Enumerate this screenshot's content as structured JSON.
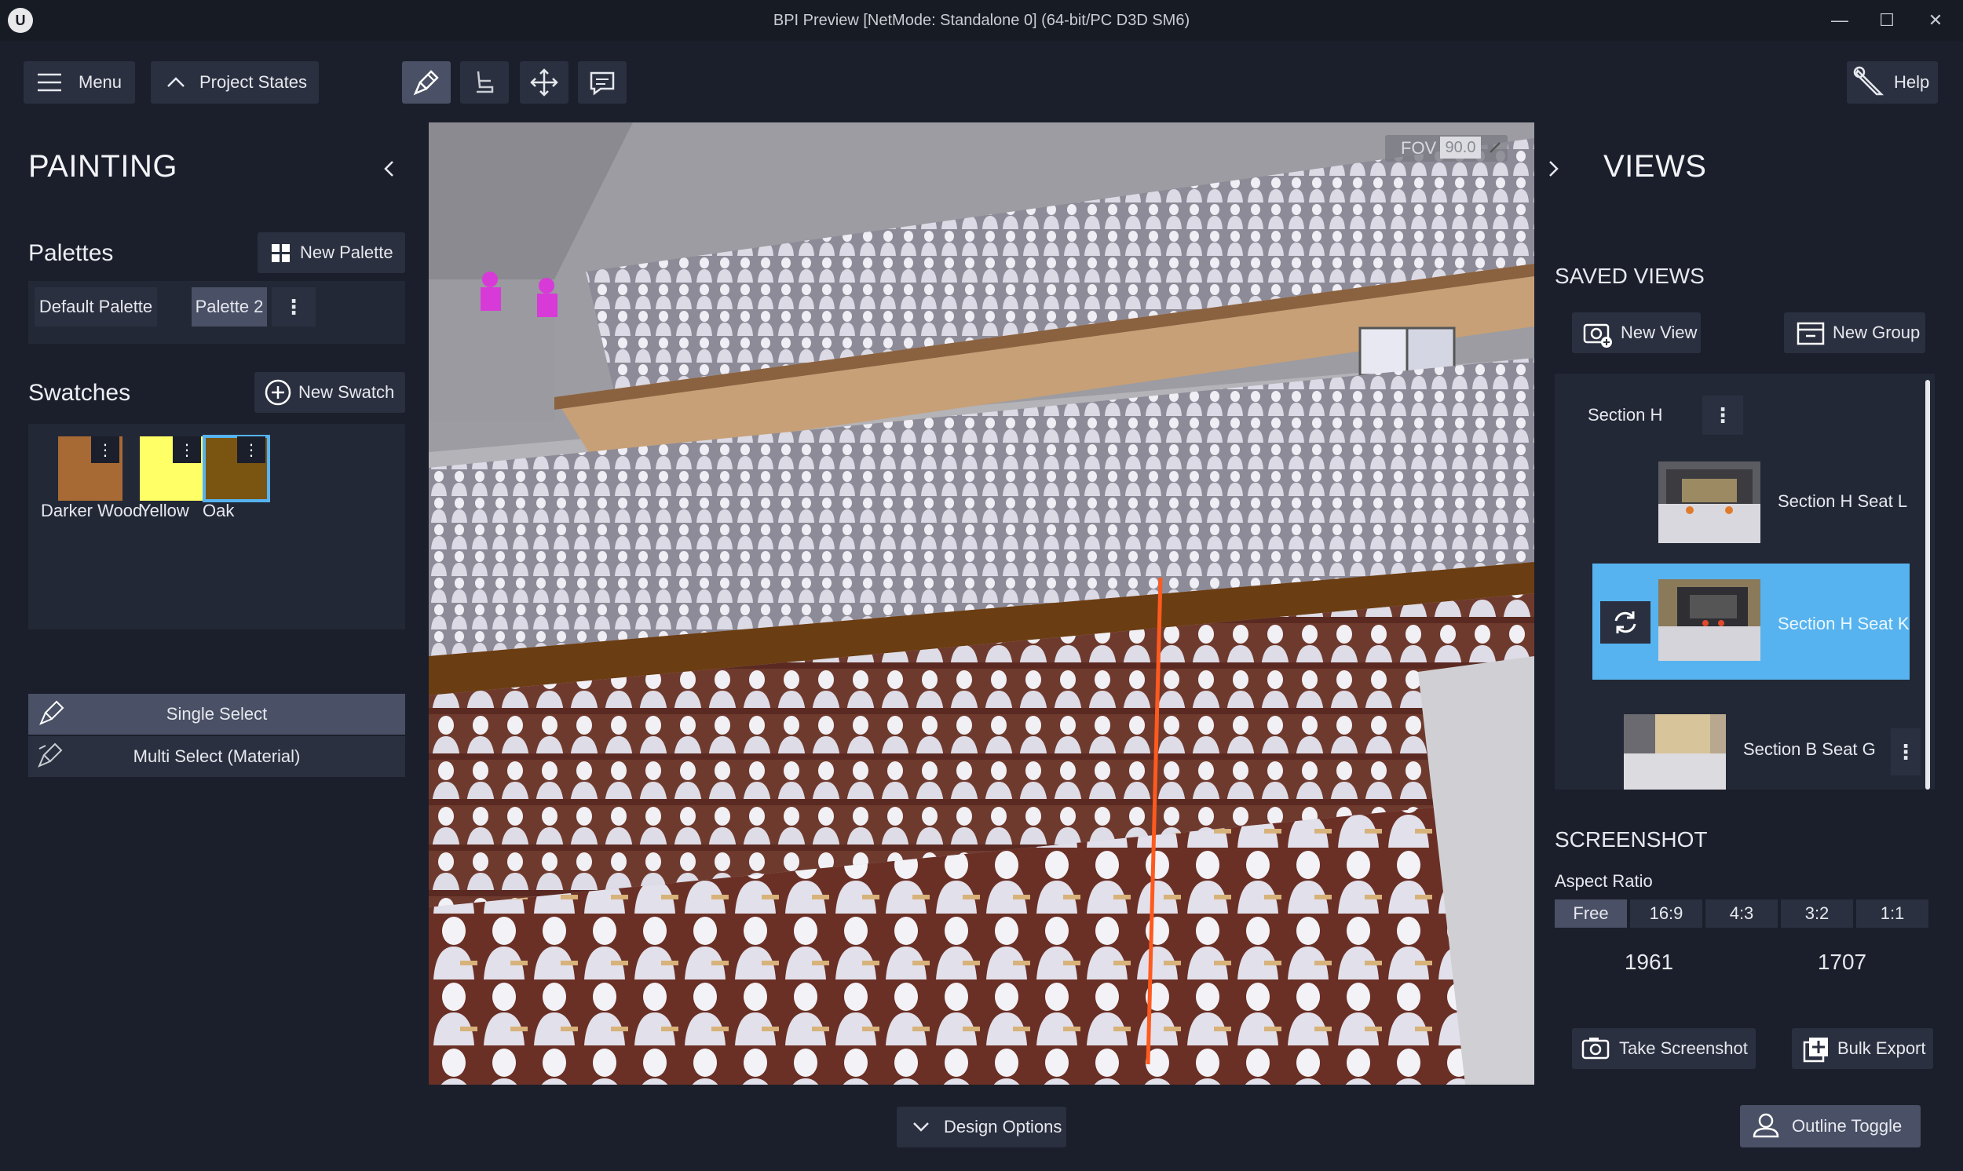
{
  "window": {
    "title": "BPI Preview [NetMode: Standalone 0]  (64-bit/PC D3D SM6)",
    "logo_text": "U",
    "minimize_glyph": "—",
    "maximize_glyph": "☐",
    "close_glyph": "✕"
  },
  "toolbar": {
    "menu_label": "Menu",
    "project_states_label": "Project States",
    "help_label": "Help",
    "tools": [
      "paint-brush-icon",
      "seat-icon",
      "move-icon",
      "comment-icon"
    ],
    "active_tool": "paint-brush-icon"
  },
  "painting": {
    "title": "PAINTING",
    "palettes_title": "Palettes",
    "new_palette_label": "New Palette",
    "palettes": [
      "Default Palette",
      "Palette 2"
    ],
    "selected_palette": "Palette 2",
    "swatches_title": "Swatches",
    "new_swatch_label": "New Swatch",
    "swatches": [
      {
        "label": "Darker Wood",
        "color": "#a86a34"
      },
      {
        "label": "Yellow",
        "color": "#ffff66"
      },
      {
        "label": "Oak",
        "color": "#7a5512"
      }
    ],
    "selected_swatch": "Oak",
    "single_select_label": "Single Select",
    "multi_select_label": "Multi Select (Material)"
  },
  "viewport": {
    "fov_label": "FOV",
    "fov_value": "90.0"
  },
  "views": {
    "title": "VIEWS",
    "saved_views_title": "SAVED VIEWS",
    "new_view_label": "New View",
    "new_group_label": "New Group",
    "group_name": "Section H",
    "items": [
      {
        "label": "Section H Seat L"
      },
      {
        "label": "Section H Seat K"
      },
      {
        "label": "Section B Seat G"
      }
    ],
    "selected_item": "Section H Seat K"
  },
  "screenshot": {
    "title": "SCREENSHOT",
    "aspect_ratio_label": "Aspect Ratio",
    "ratios": [
      "Free",
      "16:9",
      "4:3",
      "3:2",
      "1:1"
    ],
    "selected_ratio": "Free",
    "width": "1961",
    "height": "1707",
    "take_screenshot_label": "Take Screenshot",
    "bulk_export_label": "Bulk Export"
  },
  "bottom": {
    "design_options_label": "Design Options",
    "outline_toggle_label": "Outline Toggle"
  },
  "colors": {
    "background": "#1b1f2b",
    "button": "#2b3040",
    "button_active": "#4a5065",
    "selection_blue": "#56b3ef",
    "accent_magenta": "#d83ad8"
  }
}
